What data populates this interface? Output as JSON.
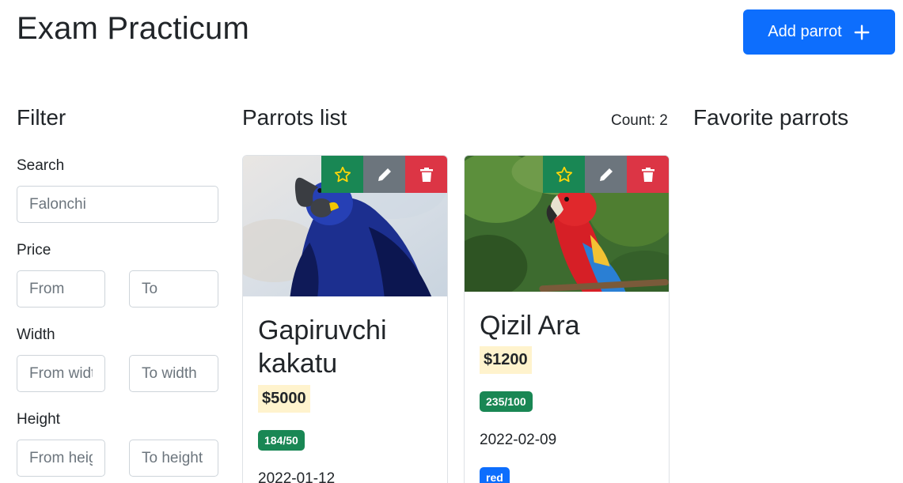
{
  "header": {
    "title": "Exam Practicum",
    "add_button_label": "Add parrot"
  },
  "filter": {
    "title": "Filter",
    "search": {
      "label": "Search",
      "placeholder": "Falonchi"
    },
    "price": {
      "label": "Price",
      "from_placeholder": "From",
      "to_placeholder": "To"
    },
    "width": {
      "label": "Width",
      "from_placeholder": "From width",
      "to_placeholder": "To width"
    },
    "height": {
      "label": "Height",
      "from_placeholder": "From height",
      "to_placeholder": "To height"
    }
  },
  "list": {
    "title": "Parrots list",
    "count_text": "Count: 2",
    "parrots": [
      {
        "name": "Gapiruvchi kakatu",
        "price": "$5000",
        "size": "184/50",
        "date": "2022-01-12"
      },
      {
        "name": "Qizil Ara",
        "price": "$1200",
        "size": "235/100",
        "date": "2022-02-09",
        "feature": "red"
      }
    ]
  },
  "favorites": {
    "title": "Favorite parrots"
  },
  "icons": {
    "add": "plus-icon",
    "favorite": "star-icon",
    "edit": "pencil-icon",
    "delete": "trash-icon"
  },
  "colors": {
    "primary": "#0d6efd",
    "success": "#198754",
    "secondary": "#6c757d",
    "danger": "#dc3545",
    "star": "#ffc107",
    "price_bg": "#fff3cd"
  }
}
